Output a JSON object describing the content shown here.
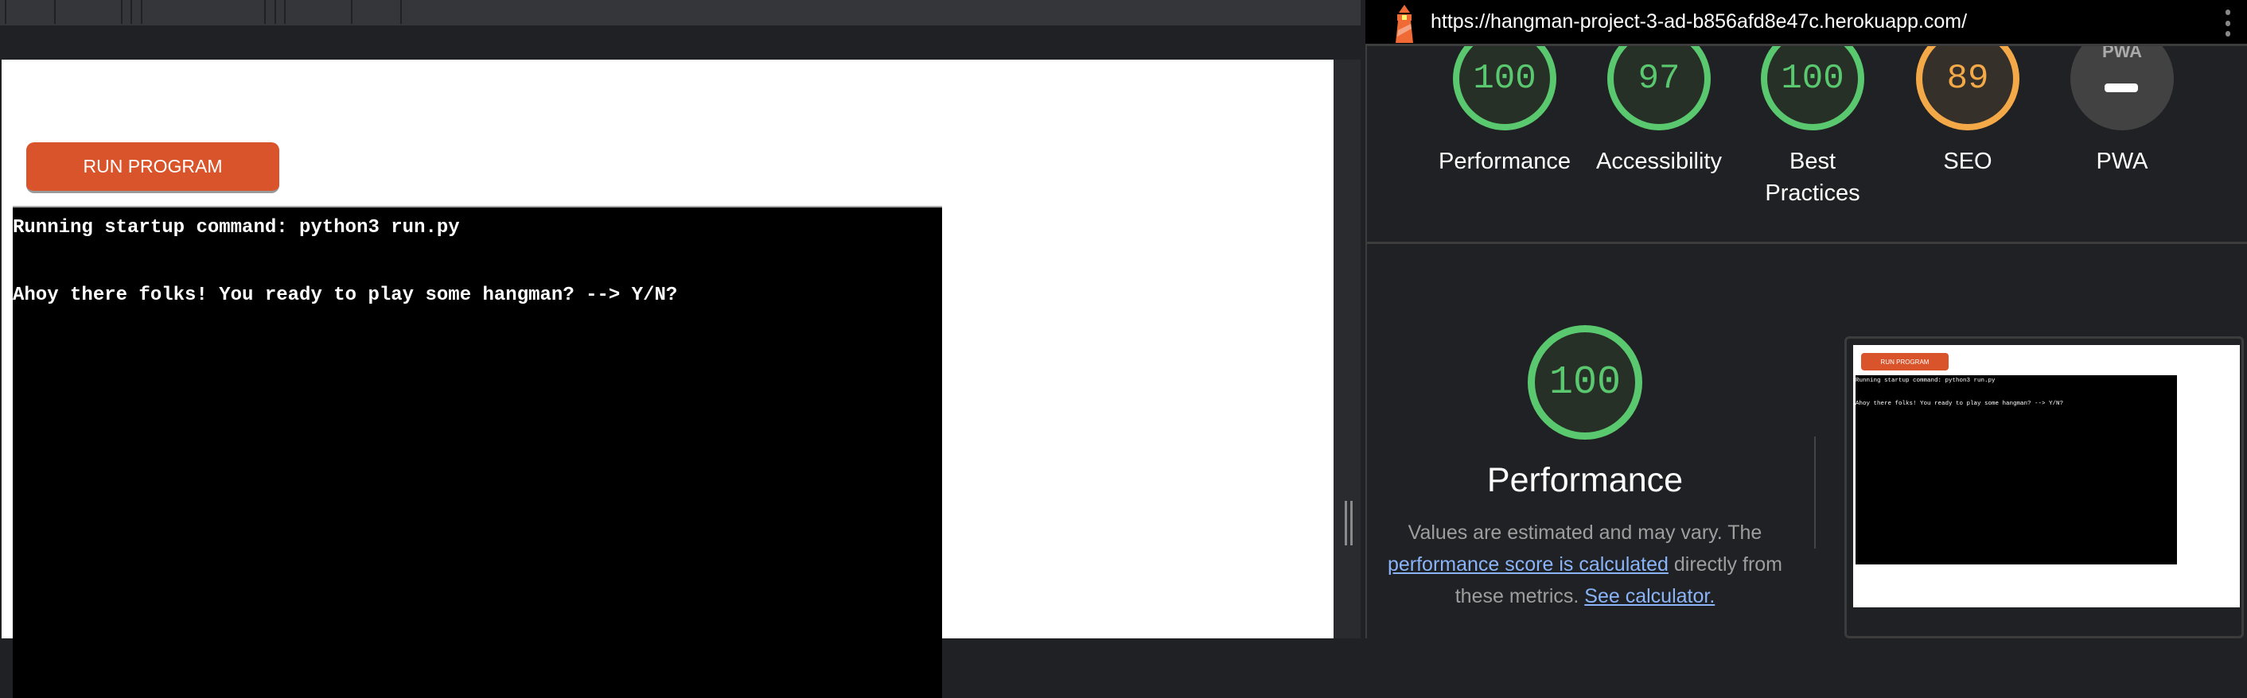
{
  "left_pane": {
    "run_button_label": "RUN PROGRAM",
    "terminal_lines": [
      "Running startup command: python3 run.py",
      "Ahoy there folks! You ready to play some hangman? --> Y/N?"
    ]
  },
  "lighthouse": {
    "url": "https://hangman-project-3-ad-b856afd8e47c.herokuapp.com/",
    "scores": [
      {
        "label": "Performance",
        "value": "100",
        "status": "pass",
        "color": "#5ac86e"
      },
      {
        "label": "Accessibility",
        "value": "97",
        "status": "pass",
        "color": "#5ac86e"
      },
      {
        "label": "Best Practices",
        "value": "100",
        "status": "pass",
        "color": "#5ac86e"
      },
      {
        "label": "SEO",
        "value": "89",
        "status": "average",
        "color": "#f4a949"
      },
      {
        "label": "PWA",
        "value": "PWA",
        "status": "na",
        "color": "#9e9e9e"
      }
    ],
    "detail": {
      "score": "100",
      "title": "Performance",
      "desc_1": "Values are estimated and may vary. The",
      "link_1": "performance score is calculated",
      "desc_2": " directly from these metrics. ",
      "link_2": "See calculator."
    },
    "thumbnail": {
      "button_label": "RUN PROGRAM",
      "lines": [
        "Running startup command: python3 run.py",
        "Ahoy there folks! You ready to play some hangman? --> Y/N?"
      ]
    }
  }
}
